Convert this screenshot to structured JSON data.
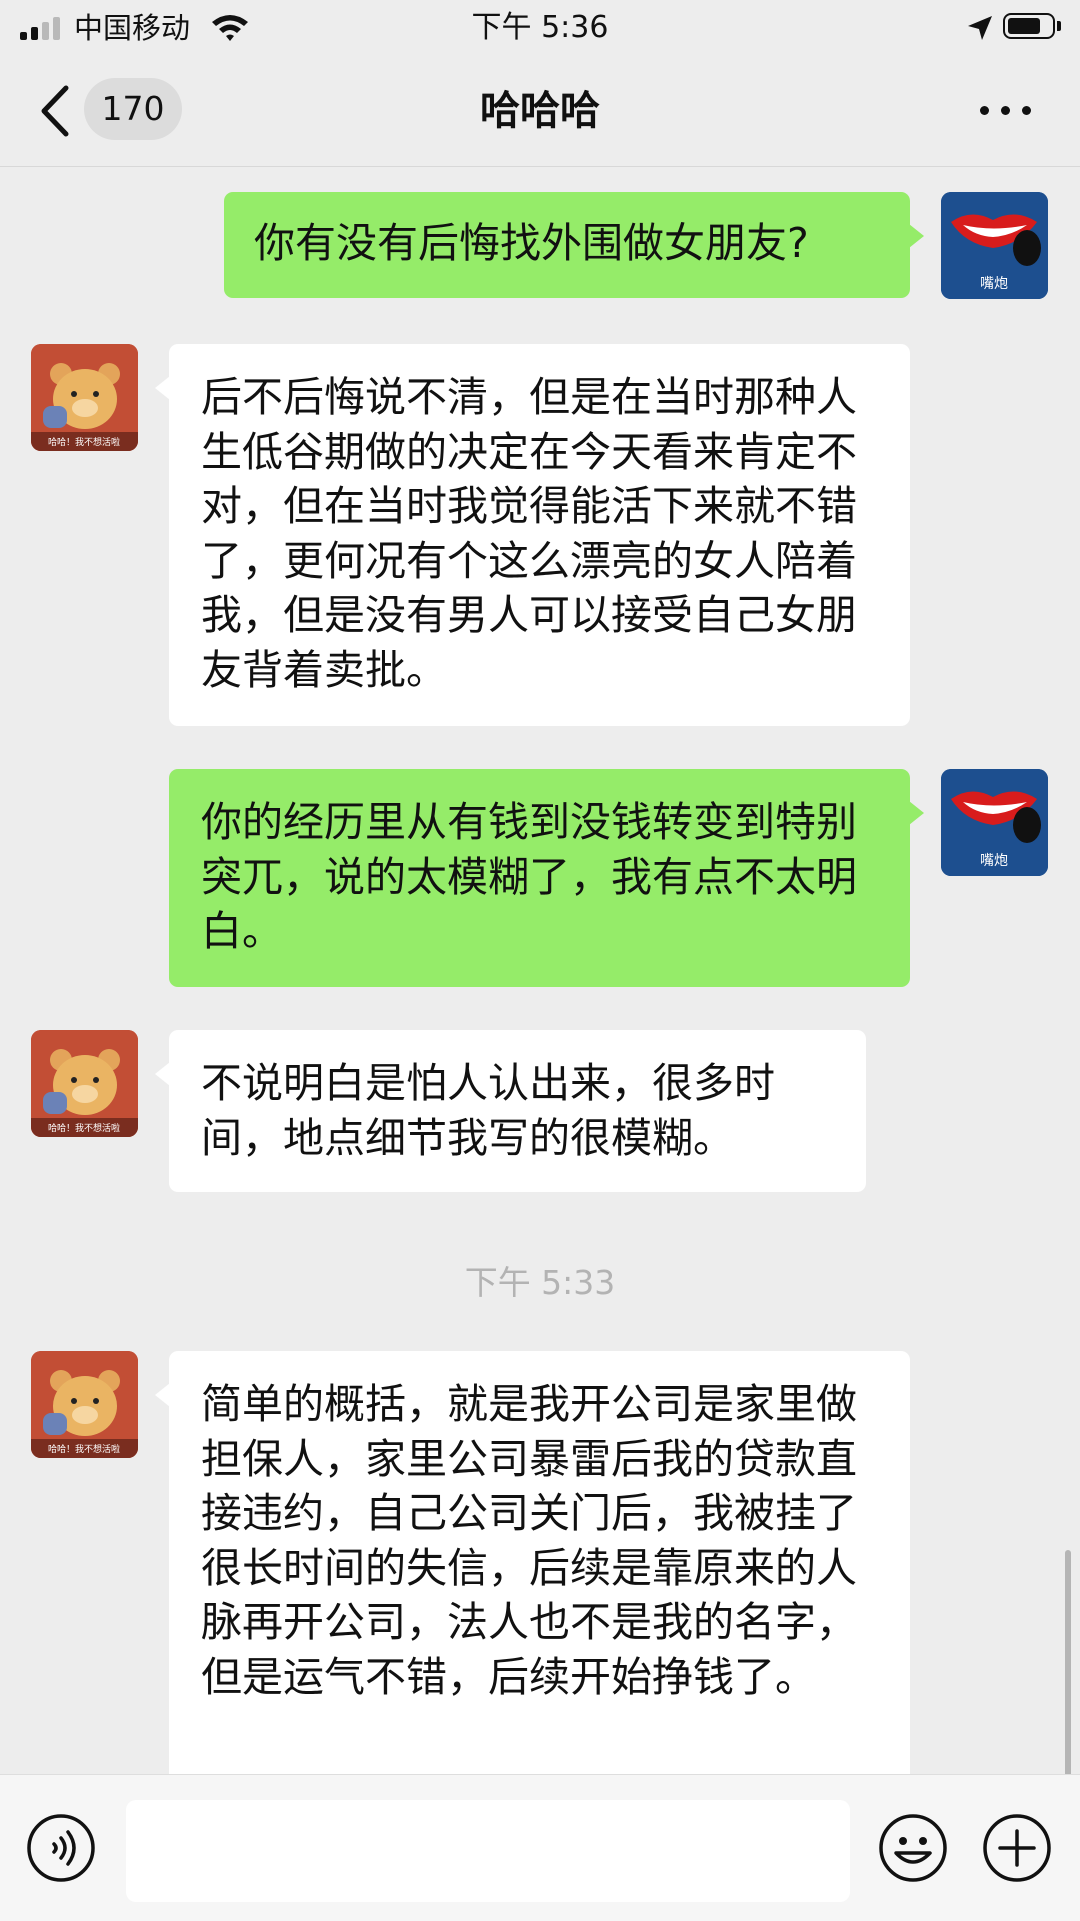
{
  "status_bar": {
    "carrier": "中国移动",
    "time": "下午 5:36"
  },
  "nav": {
    "unread_count": "170",
    "title": "哈哈哈"
  },
  "avatars": {
    "self_caption": "嘴炮",
    "other_caption": "哈哈！我不想活啦"
  },
  "messages": [
    {
      "side": "sent",
      "text": "你有没有后悔找外围做女朋友?"
    },
    {
      "side": "received",
      "text": "后不后悔说不清，但是在当时那种人生低谷期做的决定在今天看来肯定不对，但在当时我觉得能活下来就不错了，更何况有个这么漂亮的女人陪着我，但是没有男人可以接受自己女朋友背着卖批。"
    },
    {
      "side": "sent",
      "text": "你的经历里从有钱到没钱转变到特别突兀，说的太模糊了，我有点不太明白。"
    },
    {
      "side": "received",
      "text": "不说明白是怕人认出来，很多时间，地点细节我写的很模糊。"
    },
    {
      "side": "received",
      "text": "简单的概括，就是我开公司是家里做担保人，家里公司暴雷后我的贷款直接违约，自己公司关门后，我被挂了很长时间的失信，后续是靠原来的人脉再开公司，法人也不是我的名字，但是运气不错，后续开始挣钱了。"
    }
  ],
  "timestamp": "下午 5:33",
  "input": {
    "value": ""
  },
  "icons": {
    "back": "chevron-left-icon",
    "more": "more-dots-icon",
    "voice": "voice-icon",
    "emoji": "emoji-icon",
    "plus": "plus-icon",
    "wifi": "wifi-icon",
    "location": "location-arrow-icon",
    "battery": "battery-icon"
  },
  "colors": {
    "sent_bubble": "#95ec69",
    "received_bubble": "#ffffff",
    "background": "#ededed"
  }
}
